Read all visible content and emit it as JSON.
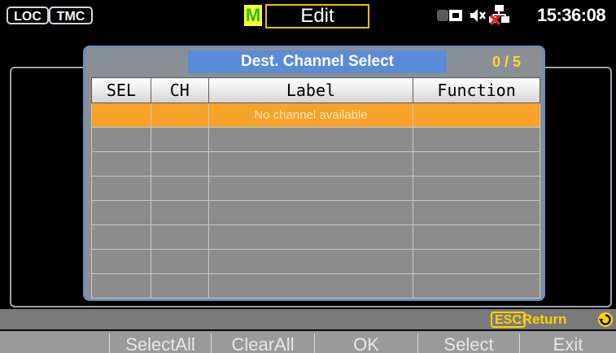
{
  "status": {
    "loc": "LOC",
    "tmc": "TMC",
    "mode": "M",
    "edit": "Edit",
    "time": "15:36:08"
  },
  "dialog": {
    "title": "Dest. Channel Select",
    "count": "0 / 5",
    "columns": [
      "SEL",
      "CH",
      "Label",
      "Function"
    ],
    "empty_row_label": "No channel available"
  },
  "esc": {
    "key": "ESC",
    "action": ":Return"
  },
  "softkeys": [
    "",
    "SelectAll",
    "ClearAll",
    "OK",
    "Select",
    "Exit"
  ],
  "colors": {
    "highlight": "#f7a228",
    "title_bar": "#5a8bd8",
    "esc_yellow": "#ffd200"
  }
}
